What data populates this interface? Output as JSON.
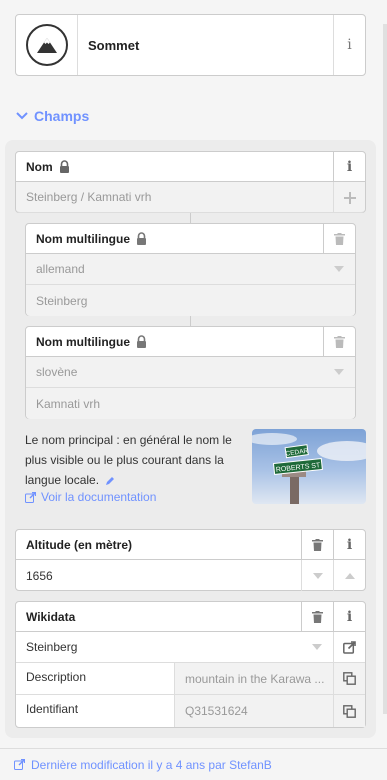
{
  "preset": {
    "name": "Sommet",
    "icon": "mountain-peak-icon",
    "info_label": "i"
  },
  "section": {
    "label": "Champs",
    "expanded": true
  },
  "name_field": {
    "label": "Nom",
    "value": "Steinberg / Kamnati vrh",
    "info_label": "i"
  },
  "multilingual": [
    {
      "label": "Nom multilingue",
      "language": "allemand",
      "value": "Steinberg"
    },
    {
      "label": "Nom multilingue",
      "language": "slovène",
      "value": "Kamnati vrh"
    }
  ],
  "help": {
    "text": "Le nom principal : en général le nom le plus visible ou le plus courant dans la langue locale.",
    "doc_link": "Voir la documentation",
    "image_signs": [
      "CEDAR",
      "ROBERTS ST"
    ]
  },
  "altitude_field": {
    "label": "Altitude (en mètre)",
    "value": "1656",
    "info_label": "i"
  },
  "wikidata_field": {
    "label": "Wikidata",
    "value": "Steinberg",
    "info_label": "i",
    "rows": [
      {
        "key": "Description",
        "value": "mountain in the Karawa ..."
      },
      {
        "key": "Identifiant",
        "value": "Q31531624"
      }
    ]
  },
  "footer": {
    "text": "Dernière modification il y a 4 ans par StefanB"
  },
  "colors": {
    "accent": "#7092ff",
    "border": "#cccccc",
    "panel": "#ececec"
  }
}
